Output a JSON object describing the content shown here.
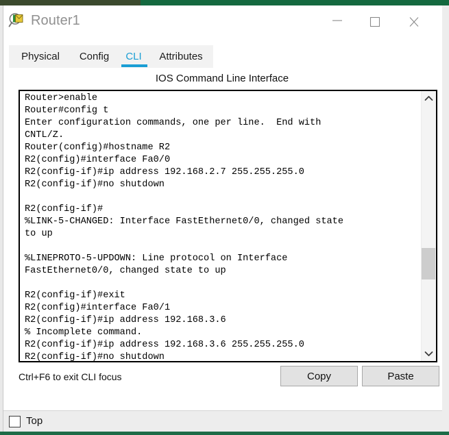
{
  "window": {
    "title": "Router1",
    "icon": "router-magnifier-icon",
    "controls": {
      "minimize": "minimize-icon",
      "maximize": "maximize-icon",
      "close": "close-icon"
    }
  },
  "tabs": [
    {
      "label": "Physical",
      "active": false
    },
    {
      "label": "Config",
      "active": false
    },
    {
      "label": "CLI",
      "active": true
    },
    {
      "label": "Attributes",
      "active": false
    }
  ],
  "panel": {
    "title": "IOS Command Line Interface",
    "terminal_text": "Router>enable\nRouter#config t\nEnter configuration commands, one per line.  End with\nCNTL/Z.\nRouter(config)#hostname R2\nR2(config)#interface Fa0/0\nR2(config-if)#ip address 192.168.2.7 255.255.255.0\nR2(config-if)#no shutdown\n\nR2(config-if)#\n%LINK-5-CHANGED: Interface FastEthernet0/0, changed state\nto up\n\n%LINEPROTO-5-UPDOWN: Line protocol on Interface\nFastEthernet0/0, changed state to up\n\nR2(config-if)#exit\nR2(config)#interface Fa0/1\nR2(config-if)#ip address 192.168.3.6\n% Incomplete command.\nR2(config-if)#ip address 192.168.3.6 255.255.255.0\nR2(config-if)#no shutdown",
    "focus_hint": "Ctrl+F6 to exit CLI focus",
    "copy_label": "Copy",
    "paste_label": "Paste",
    "scrollbar": {
      "up_icon": "chevron-up-icon",
      "down_icon": "chevron-down-icon"
    }
  },
  "bottom": {
    "top_checkbox_label": "Top",
    "top_checkbox_checked": false
  },
  "colors": {
    "accent": "#1a9ed4",
    "desktop_green": "#14693f",
    "title_text": "#909090",
    "button_face": "#e2e2e2"
  }
}
